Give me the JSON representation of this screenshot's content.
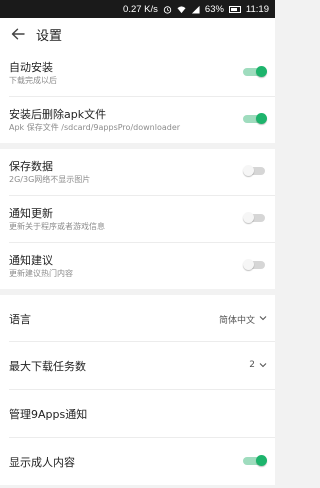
{
  "status_bar": {
    "speed": "0.27 K/s",
    "battery": "63%",
    "time": "11:19"
  },
  "header": {
    "title": "设置"
  },
  "group1": [
    {
      "title": "自动安装",
      "subtitle": "下载完成以后",
      "toggle": true
    },
    {
      "title": "安装后删除apk文件",
      "subtitle": "Apk 保存文件 /sdcard/9appsPro/downloader",
      "toggle": true
    }
  ],
  "group2": [
    {
      "title": "保存数据",
      "subtitle": "2G/3G网络不显示图片",
      "toggle": false
    },
    {
      "title": "通知更新",
      "subtitle": "更新关于程序或者游戏信息",
      "toggle": false
    },
    {
      "title": "通知建议",
      "subtitle": "更新建议热门内容",
      "toggle": false
    }
  ],
  "group3": {
    "language": {
      "title": "语言",
      "value": "简体中文"
    },
    "max_downloads": {
      "title": "最大下载任务数",
      "value": "2"
    },
    "manage_notify": {
      "title": "管理9Apps通知"
    },
    "adult": {
      "title": "显示成人内容",
      "toggle": true
    }
  },
  "colors": {
    "accent": "#1db46c",
    "accent_track": "#9fdcbe",
    "background": "#f2f2f2"
  }
}
